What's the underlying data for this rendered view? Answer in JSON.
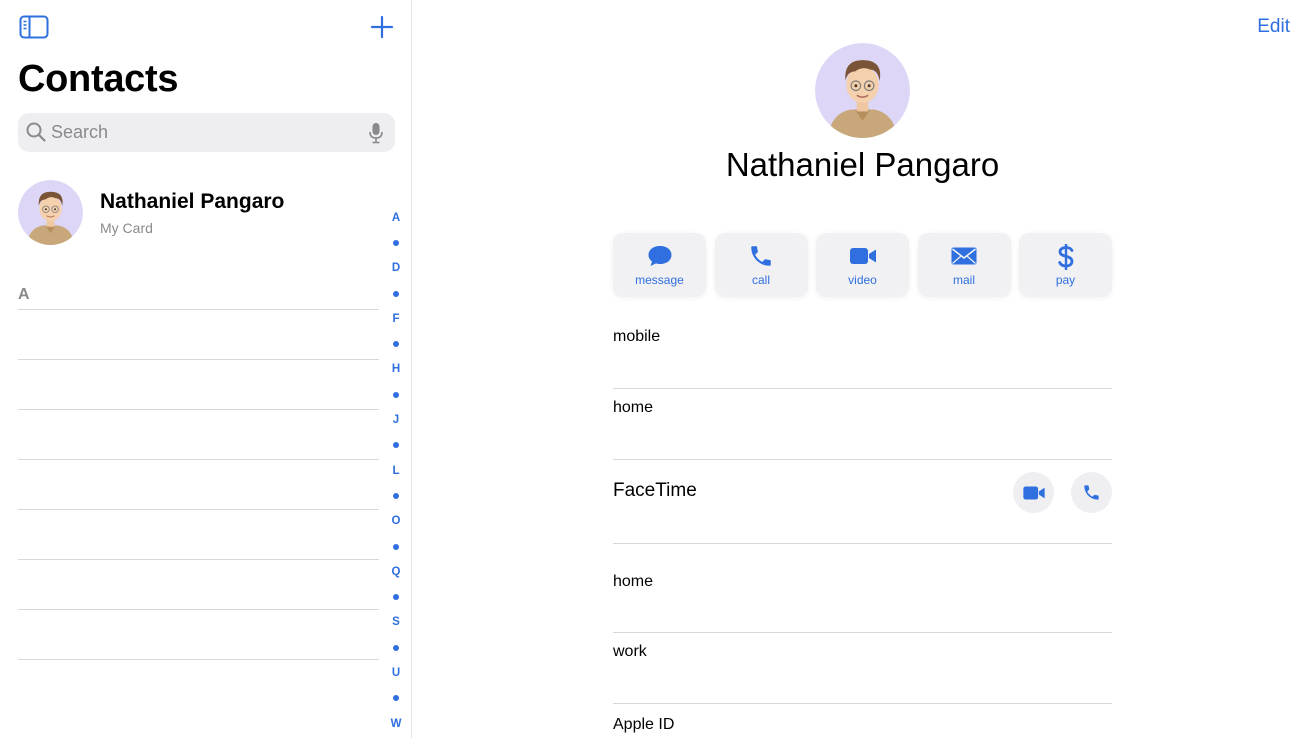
{
  "sidebar": {
    "title": "Contacts",
    "search_placeholder": "Search",
    "my_card": {
      "name": "Nathaniel Pangaro",
      "subtitle": "My Card"
    },
    "section_header": "A",
    "row_count_visible": 8,
    "index_letters": [
      "A",
      "D",
      "F",
      "H",
      "J",
      "L",
      "O",
      "Q",
      "S",
      "U",
      "W"
    ]
  },
  "detail": {
    "edit_label": "Edit",
    "name": "Nathaniel Pangaro",
    "actions": [
      {
        "label": "message",
        "icon": "message-bubble-icon"
      },
      {
        "label": "call",
        "icon": "phone-icon"
      },
      {
        "label": "video",
        "icon": "video-camera-icon"
      },
      {
        "label": "mail",
        "icon": "envelope-icon"
      },
      {
        "label": "pay",
        "icon": "dollar-sign-icon"
      }
    ],
    "fields": {
      "mobile": "mobile",
      "home_phone": "home",
      "facetime": "FaceTime",
      "home_email": "home",
      "work_email": "work",
      "apple_id": "Apple ID"
    }
  },
  "colors": {
    "accent": "#2f6fdf",
    "avatar_bg": "#ddd6f6",
    "button_bg": "#f1f1f4"
  }
}
